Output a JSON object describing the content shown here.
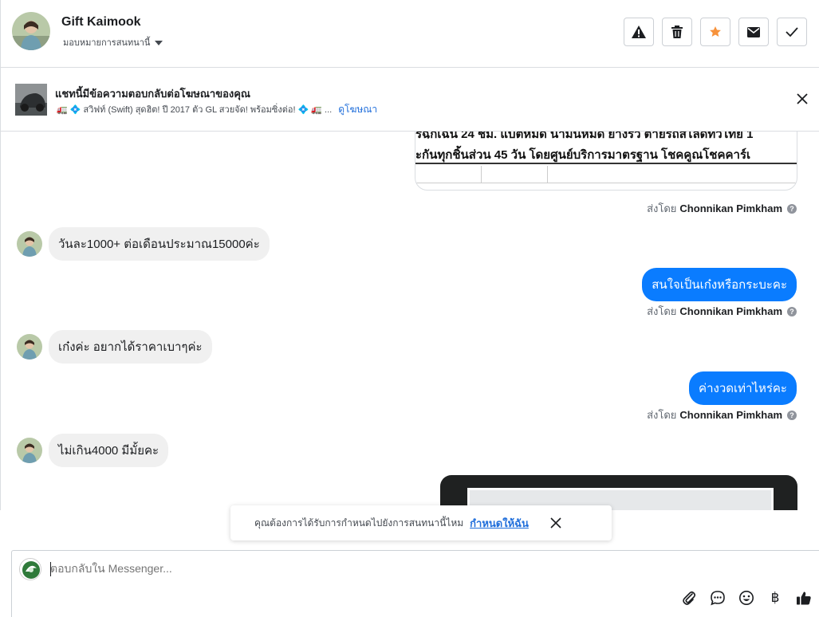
{
  "header": {
    "contact_name": "Gift Kaimook",
    "assign_label": "มอบหมายการสนทนานี้",
    "actions": [
      "alert-icon",
      "trash-icon",
      "star-icon",
      "envelope-icon",
      "check-icon"
    ]
  },
  "ad_banner": {
    "title": "แชทนี้มีข้อความตอบกลับต่อโฆษณาของคุณ",
    "description": "🚛 💠 สวิฟท์ (Swift) สุดฮิต! ปี 2017 ตัว GL สวยจัด! พร้อมซิ่งต่อ! 💠 🚛 ...",
    "link": "ดูโฆษณา"
  },
  "thread": {
    "attachment_lines": [
      "รฉุกเฉิน 24 ชม. แบตหมด น้ำมันหมด ยางรั่ว ตายรถสไลด์ทั่วไทย 1",
      "ะกันทุกชิ้นส่วน 45 วัน โดยศูนย์บริการมาตรฐาน โชคคูณโชคคาร์เ"
    ],
    "sent_by_prefix": "ส่งโดย",
    "sent_by_name": "Chonnikan Pimkham",
    "help_glyph": "?",
    "messages": [
      {
        "direction": "in",
        "text": "วันละ1000+ ต่อเดือนประมาณ15000ค่ะ"
      },
      {
        "direction": "out",
        "text": "สนใจเป็นเก๋งหรือกระบะคะ"
      },
      {
        "direction": "in",
        "text": "เก๋งค่ะ อยากได้ราคาเบาๆค่ะ"
      },
      {
        "direction": "out",
        "text": "ค่างวดเท่าไหร่คะ"
      },
      {
        "direction": "in",
        "text": "ไม่เกิน4000 มีมั้ยคะ"
      }
    ]
  },
  "toast": {
    "message": "คุณต้องการได้รับการกำหนดไปยังการสนทนานี้ไหม",
    "link": "กำหนดให้ฉัน"
  },
  "composer": {
    "placeholder": "ตอบกลับใน Messenger...",
    "baht_symbol": "฿",
    "tools": [
      "paperclip-icon",
      "speech-bubble-icon",
      "emoji-icon",
      "baht-icon",
      "thumbs-up-icon"
    ]
  },
  "colors": {
    "accent": "#0a7cff",
    "link": "#216fdb",
    "star": "#f7923b"
  }
}
